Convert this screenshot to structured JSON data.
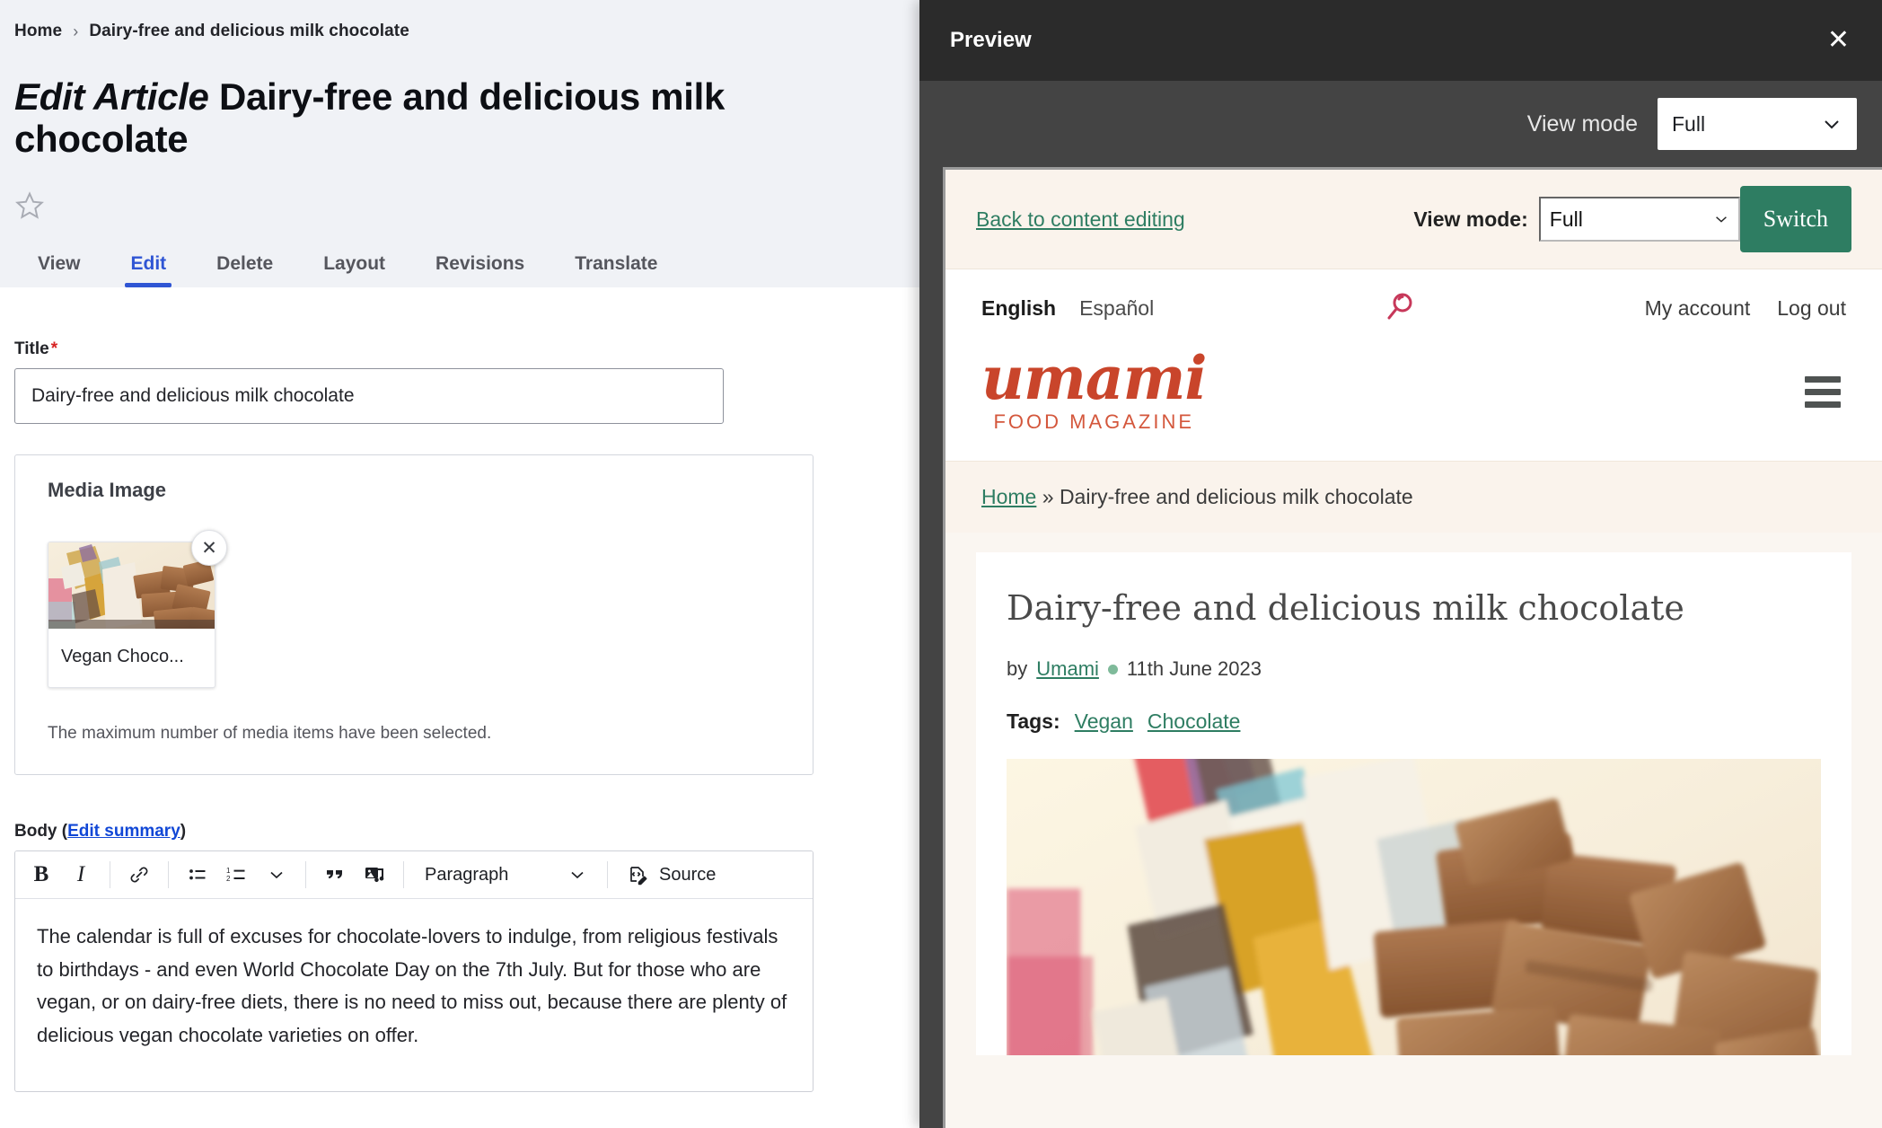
{
  "admin": {
    "breadcrumb": {
      "home": "Home",
      "separator": "›",
      "current": "Dairy-free and delicious milk chocolate"
    },
    "page_title_prefix": "Edit Article",
    "page_title": "Dairy-free and delicious milk chocolate",
    "star_icon": "star-outline-icon",
    "tabs": [
      {
        "label": "View",
        "active": false
      },
      {
        "label": "Edit",
        "active": true
      },
      {
        "label": "Delete",
        "active": false
      },
      {
        "label": "Layout",
        "active": false
      },
      {
        "label": "Revisions",
        "active": false
      },
      {
        "label": "Translate",
        "active": false
      }
    ],
    "title_field": {
      "label": "Title",
      "required_marker": "*",
      "value": "Dairy-free and delicious milk chocolate",
      "placeholder": ""
    },
    "media": {
      "panel_title": "Media Image",
      "item_name": "Vegan Choco...",
      "remove_icon": "close-x-icon",
      "note": "The maximum number of media items have been selected."
    },
    "body": {
      "label": "Body",
      "edit_summary_link": "Edit summary",
      "toolbar": {
        "bold": "B",
        "italic": "I",
        "link_icon": "link-icon",
        "bulleted_list_icon": "bulleted-list-icon",
        "numbered_list_icon": "numbered-list-icon",
        "list_dropdown_icon": "chevron-down-icon",
        "blockquote_icon": "blockquote-icon",
        "media_icon": "insert-media-icon",
        "paragraph_label": "Paragraph",
        "paragraph_dropdown_icon": "chevron-down-icon",
        "source_icon": "source-code-icon",
        "source_label": "Source"
      },
      "text": "The calendar is full of excuses for chocolate-lovers to indulge, from religious festivals to birthdays - and even World Chocolate Day on the 7th July. But for those who are vegan, or on dairy-free diets, there is no need to miss out, because there are plenty of delicious vegan chocolate varieties on offer."
    }
  },
  "preview": {
    "title": "Preview",
    "close_icon": "close-x-icon",
    "view_mode_label": "View mode",
    "view_mode_value": "Full",
    "view_mode_dropdown_icon": "chevron-down-icon",
    "inner": {
      "back_link": "Back to content editing",
      "view_mode_label": "View mode:",
      "view_mode_value": "Full",
      "switch_button": "Switch",
      "languages": [
        {
          "label": "English",
          "active": true
        },
        {
          "label": "Español",
          "active": false
        }
      ],
      "search_icon": "search-magnifier-icon",
      "account_links": [
        "My account",
        "Log out"
      ],
      "brand_name": "umami",
      "brand_tagline": "FOOD MAGAZINE",
      "menu_icon": "hamburger-menu-icon",
      "breadcrumb": {
        "home": "Home",
        "separator": "»",
        "current": "Dairy-free and delicious milk chocolate"
      },
      "article": {
        "title": "Dairy-free and delicious milk chocolate",
        "by_label": "by",
        "author": "Umami",
        "date": "11th June 2023",
        "tags_label": "Tags:",
        "tags": [
          "Vegan",
          "Chocolate"
        ],
        "hero_alt": "Pile of milk chocolate squares spilling from a colourful wrapper"
      }
    }
  },
  "colors": {
    "admin_header_bg": "#f0f2f6",
    "tab_active": "#2f55d4",
    "required_red": "#d72222",
    "link_blue": "#1147d6",
    "panel_header_bg": "#2b2b2b",
    "panel_body_bg": "#444444",
    "umami_green": "#2e7d62",
    "umami_red": "#c9452b",
    "umami_cream": "#faf3ec",
    "search_pink": "#c7385a"
  }
}
